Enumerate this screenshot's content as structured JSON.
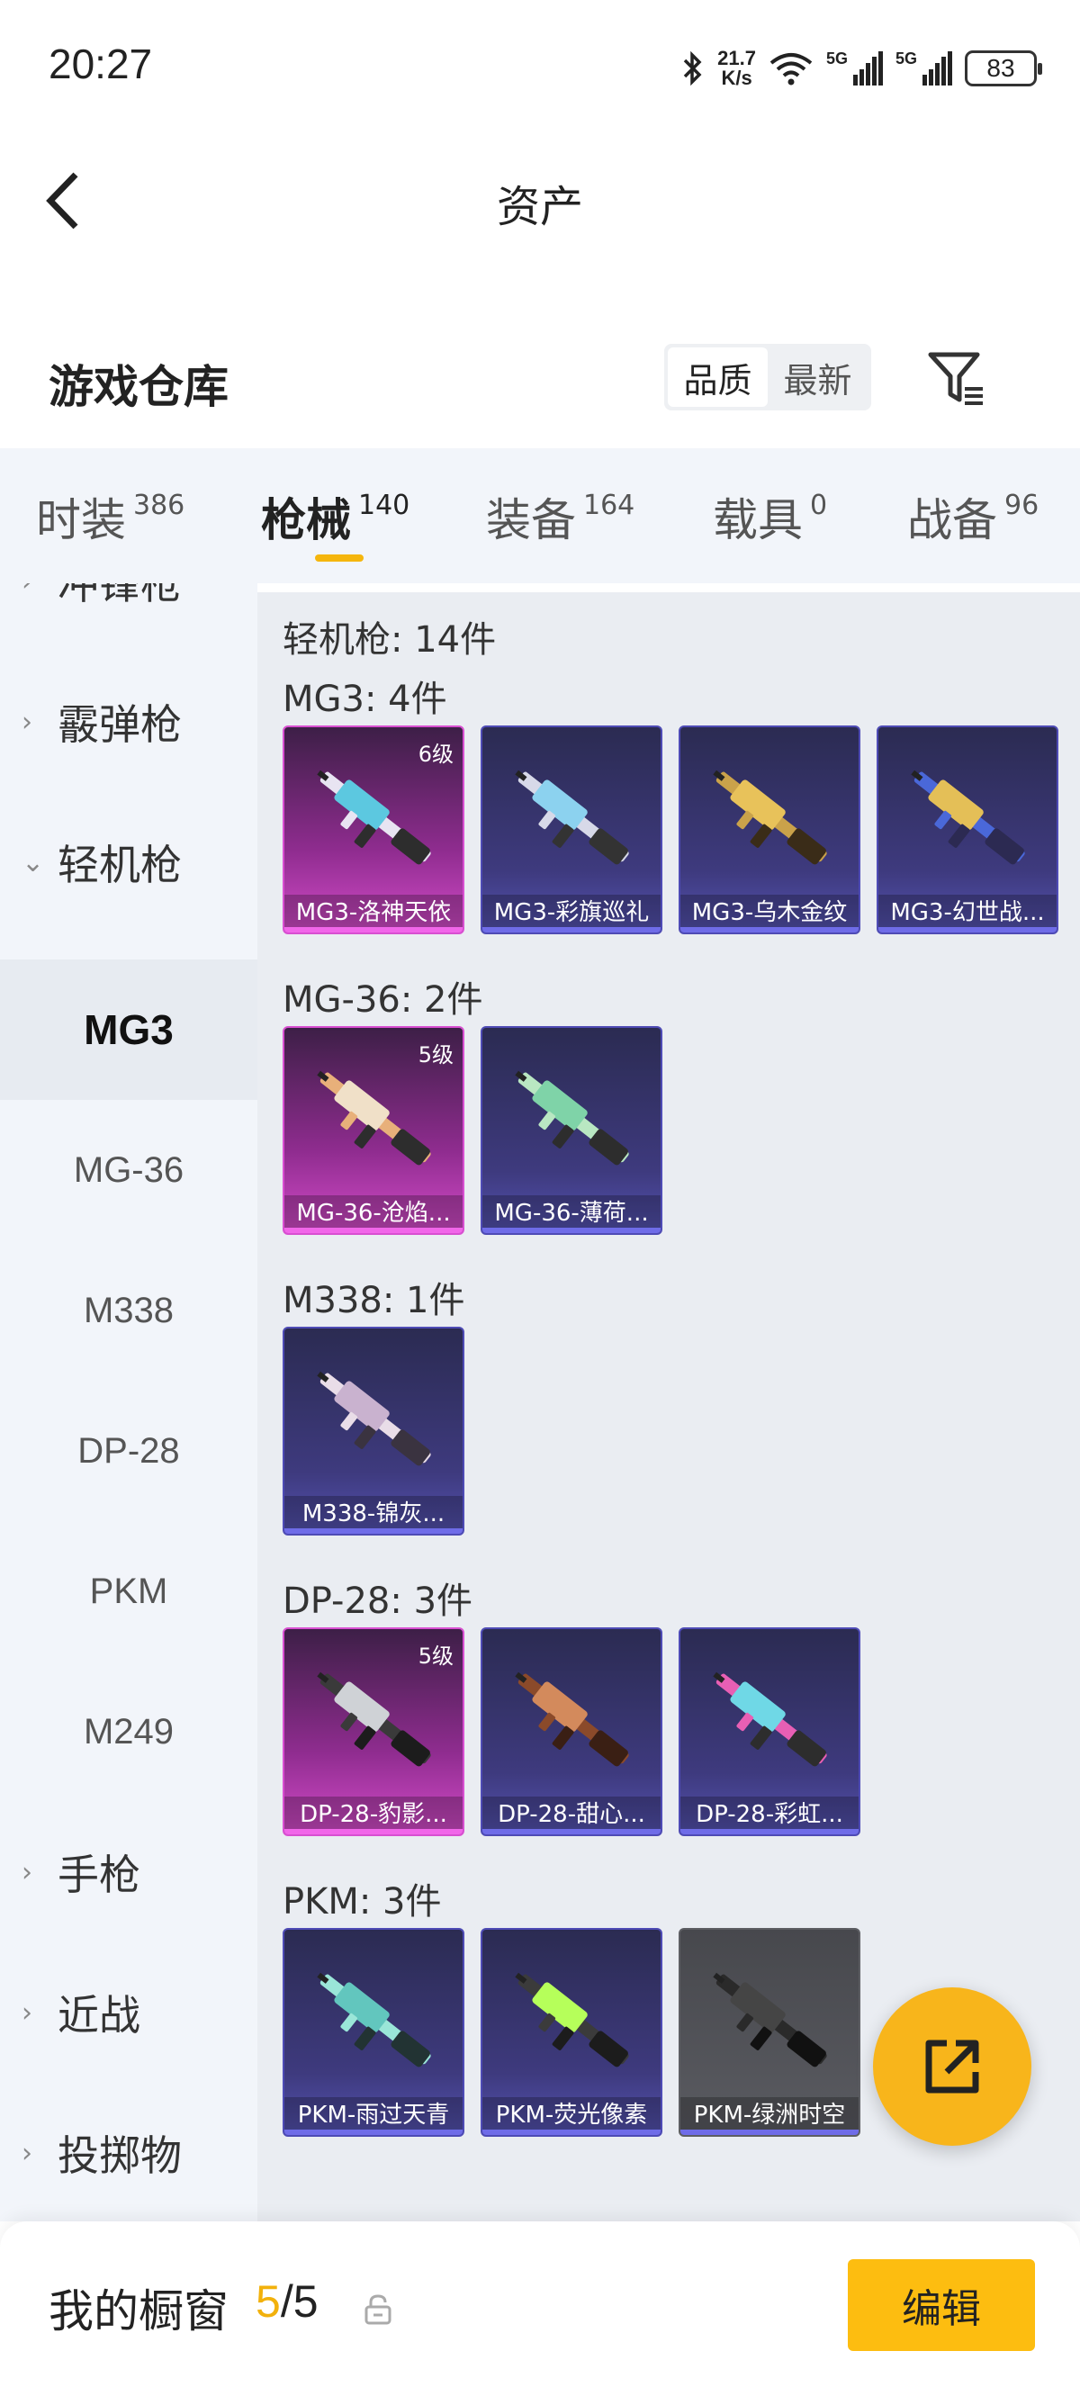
{
  "status": {
    "time": "20:27",
    "net_speed_top": "21.7",
    "net_speed_bottom": "K/s",
    "sig1_tag": "5G",
    "sig2_tag": "5G",
    "battery": "83"
  },
  "header": {
    "title": "资产"
  },
  "warehouse": {
    "title": "游戏仓库",
    "sort_quality": "品质",
    "sort_newest": "最新"
  },
  "tabs": [
    {
      "label": "时装",
      "count": "386"
    },
    {
      "label": "枪械",
      "count": "140"
    },
    {
      "label": "装备",
      "count": "164"
    },
    {
      "label": "载具",
      "count": "0"
    },
    {
      "label": "战备",
      "count": "96"
    }
  ],
  "sidebar": {
    "categories": [
      "冲锋枪",
      "霰弹枪",
      "轻机枪",
      "手枪",
      "近战",
      "投掷物"
    ],
    "subitems": [
      "MG3",
      "MG-36",
      "M338",
      "DP-28",
      "PKM",
      "M249"
    ]
  },
  "content": {
    "summary": "轻机枪: 14件",
    "sections": [
      {
        "heading": "MG3: 4件",
        "items": [
          {
            "name": "MG3-洛神天依",
            "level": "6级",
            "rarity": "legend"
          },
          {
            "name": "MG3-彩旗巡礼",
            "rarity": "epic"
          },
          {
            "name": "MG3-乌木金纹",
            "rarity": "epic"
          },
          {
            "name": "MG3-幻世战...",
            "rarity": "epic"
          }
        ]
      },
      {
        "heading": "MG-36: 2件",
        "items": [
          {
            "name": "MG-36-沧焰...",
            "level": "5级",
            "rarity": "legend"
          },
          {
            "name": "MG-36-薄荷...",
            "rarity": "epic"
          }
        ]
      },
      {
        "heading": "M338: 1件",
        "items": [
          {
            "name": "M338-锦灰...",
            "rarity": "epic"
          }
        ]
      },
      {
        "heading": "DP-28: 3件",
        "items": [
          {
            "name": "DP-28-豹影...",
            "level": "5级",
            "rarity": "legend"
          },
          {
            "name": "DP-28-甜心...",
            "rarity": "epic"
          },
          {
            "name": "DP-28-彩虹...",
            "rarity": "epic"
          }
        ]
      },
      {
        "heading": "PKM: 3件",
        "items": [
          {
            "name": "PKM-雨过天青",
            "rarity": "epic"
          },
          {
            "name": "PKM-荧光像素",
            "rarity": "epic"
          },
          {
            "name": "PKM-绿洲时空",
            "rarity": "grey"
          }
        ]
      }
    ]
  },
  "bottom": {
    "window_label": "我的橱窗",
    "window_current": "5",
    "window_total": "/5",
    "edit_label": "编辑"
  },
  "colors": {
    "accent": "#f5b60d",
    "legend": "#d84fd1",
    "epic": "#4e4bb5"
  }
}
